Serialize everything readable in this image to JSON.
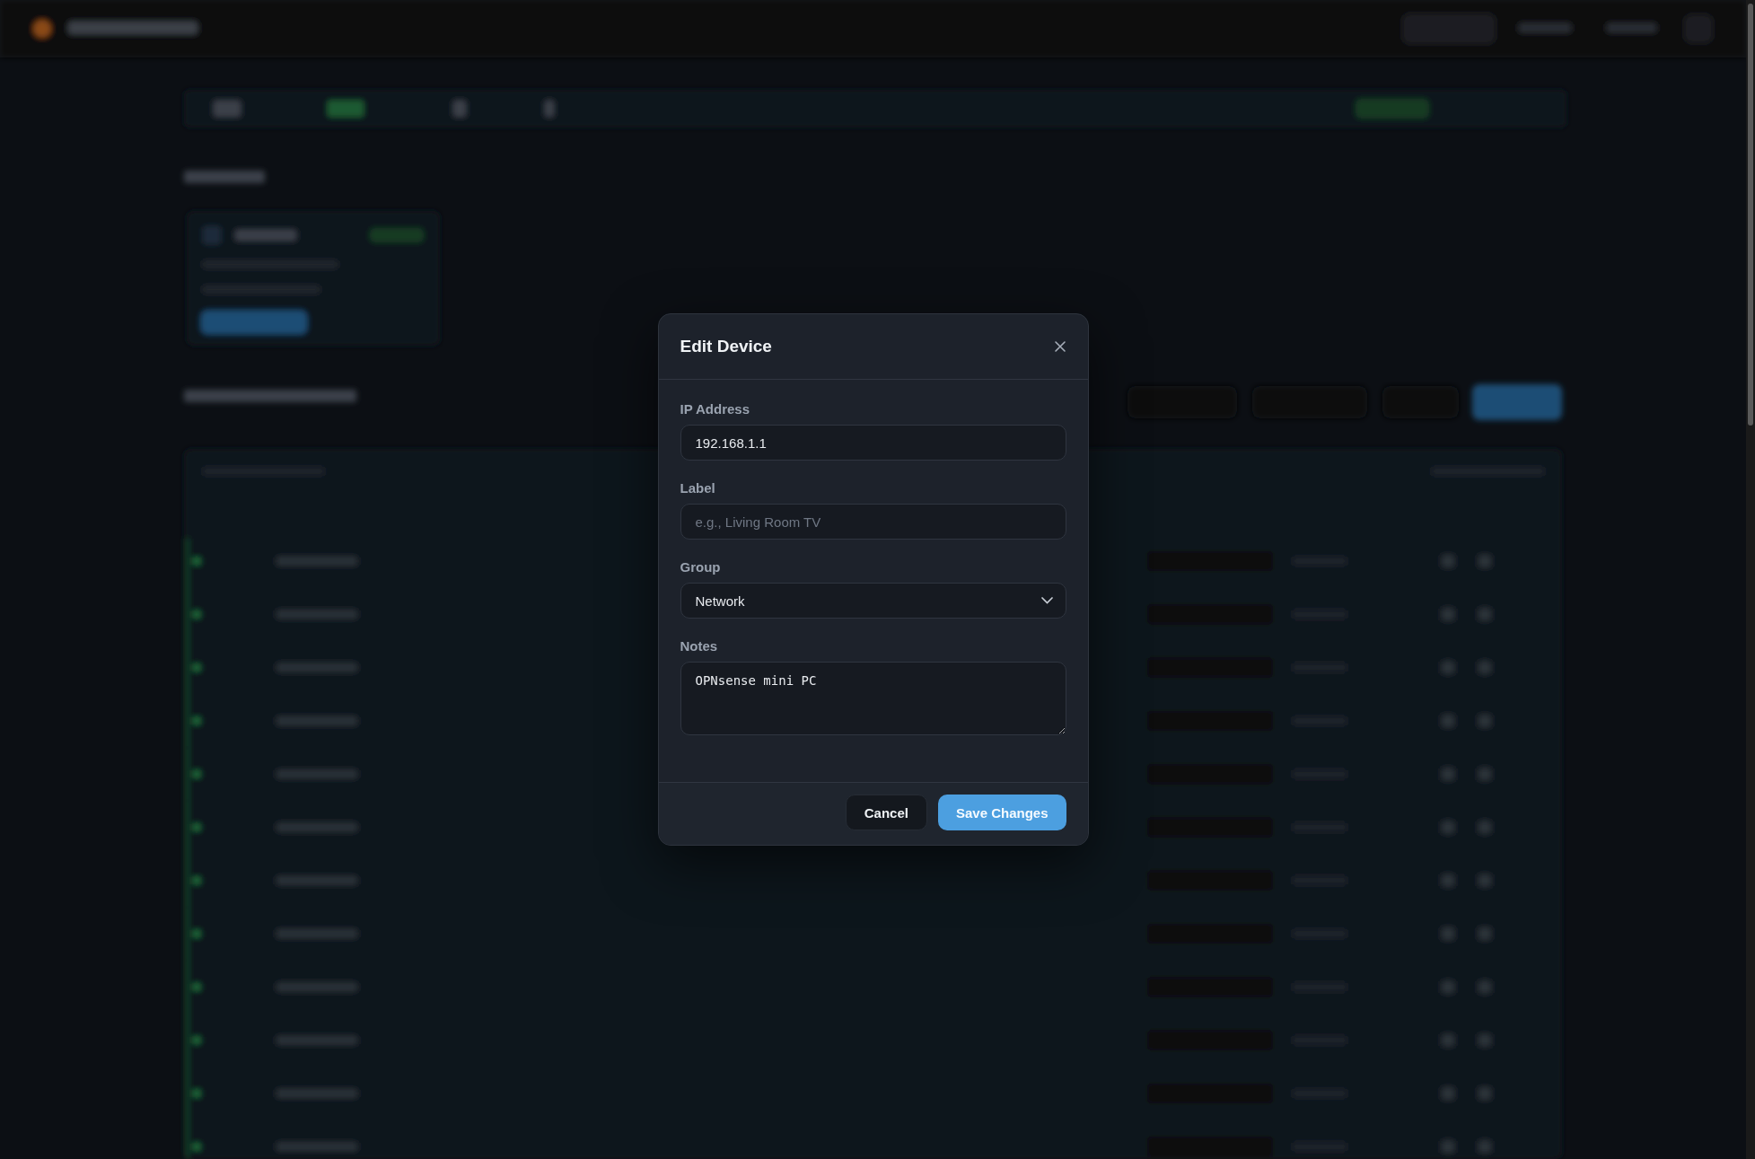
{
  "dialog": {
    "title": "Edit Device",
    "fields": [
      {
        "kind": "text",
        "label": "IP Address",
        "value": "192.168.1.1"
      },
      {
        "kind": "text",
        "label": "Label",
        "placeholder": "e.g., Living Room TV"
      },
      {
        "kind": "select",
        "label": "Group",
        "value": "Network"
      },
      {
        "kind": "textarea",
        "label": "Notes",
        "value": "OPNsense mini PC"
      }
    ],
    "buttons": [
      {
        "kind": "secondary",
        "label": "Cancel"
      },
      {
        "kind": "primary",
        "label": "Save Changes"
      }
    ]
  }
}
